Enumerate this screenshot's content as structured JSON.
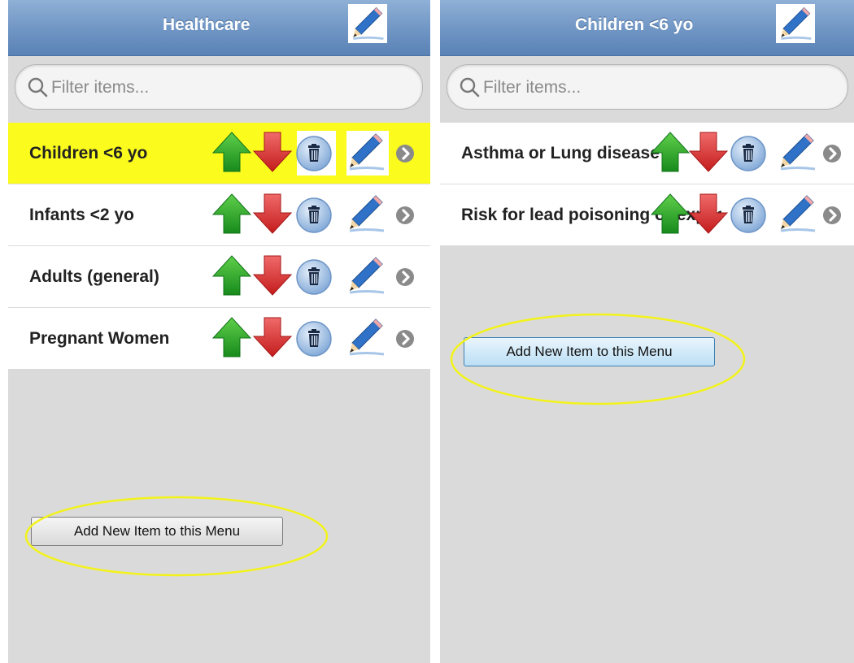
{
  "left_panel": {
    "title": "Healthcare",
    "search": {
      "placeholder": "Filter items..."
    },
    "items": [
      {
        "label": "Children <6 yo",
        "highlighted": true
      },
      {
        "label": "Infants <2 yo"
      },
      {
        "label": "Adults (general)"
      },
      {
        "label": "Pregnant Women"
      }
    ],
    "add_button": "Add New Item to this Menu"
  },
  "right_panel": {
    "title": "Children <6 yo",
    "search": {
      "placeholder": "Filter items..."
    },
    "items": [
      {
        "label": "Asthma or Lung disease"
      },
      {
        "label": "Risk for lead poisoning or exposure"
      }
    ],
    "add_button": "Add New Item to this Menu"
  },
  "icons": [
    "edit-pencil-icon",
    "search-icon",
    "arrow-up-icon",
    "arrow-down-icon",
    "trash-icon",
    "chevron-right-icon"
  ],
  "colors": {
    "header_blue": "#6f95c4",
    "row_highlight": "#fbfb1e",
    "annotation_yellow": "#f2f21a",
    "arrow_up_green": "#2e9e2e",
    "arrow_down_red": "#d9292a",
    "trash_blue": "#9fc1e6",
    "chevron_gray": "#8a8a8a"
  }
}
